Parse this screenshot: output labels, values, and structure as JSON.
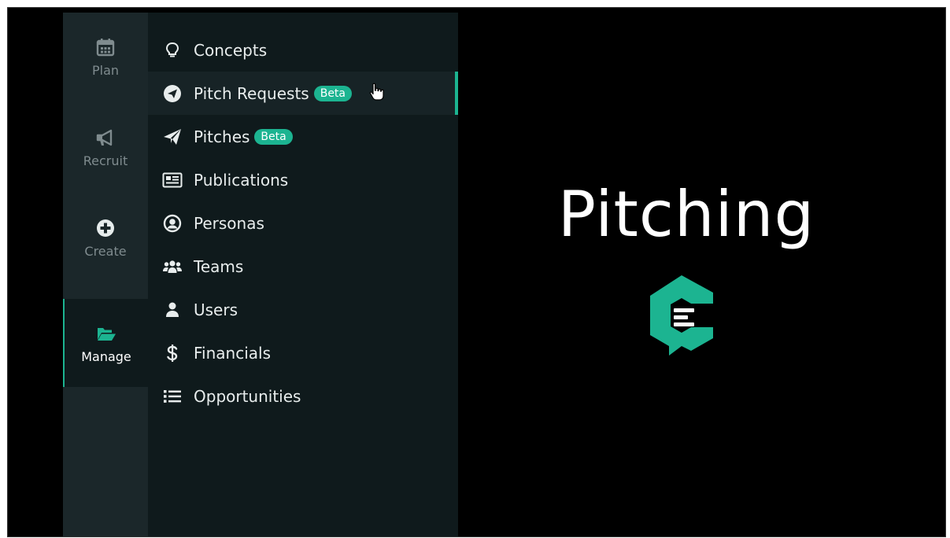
{
  "rail": {
    "items": [
      {
        "label": "Plan",
        "icon": "calendar-icon"
      },
      {
        "label": "Recruit",
        "icon": "megaphone-icon"
      },
      {
        "label": "Create",
        "icon": "plus-circle-icon"
      },
      {
        "label": "Manage",
        "icon": "folder-open-icon",
        "active": true
      }
    ]
  },
  "menu": {
    "items": [
      {
        "label": "Concepts",
        "icon": "lightbulb-icon"
      },
      {
        "label": "Pitch Requests",
        "icon": "paper-plane-circle-icon",
        "badge": "Beta",
        "hovered": true
      },
      {
        "label": "Pitches",
        "icon": "paper-plane-icon",
        "badge": "Beta"
      },
      {
        "label": "Publications",
        "icon": "newspaper-icon"
      },
      {
        "label": "Personas",
        "icon": "user-circle-icon"
      },
      {
        "label": "Teams",
        "icon": "users-icon"
      },
      {
        "label": "Users",
        "icon": "user-icon"
      },
      {
        "label": "Financials",
        "icon": "dollar-icon"
      },
      {
        "label": "Opportunities",
        "icon": "list-icon"
      }
    ]
  },
  "stage": {
    "title": "Pitching",
    "logo_icon": "brand-logo-icon"
  },
  "colors": {
    "accent": "#1cb491",
    "rail_bg": "#1b272a",
    "menu_bg": "#0f1a1c",
    "stage_bg": "#000000"
  }
}
